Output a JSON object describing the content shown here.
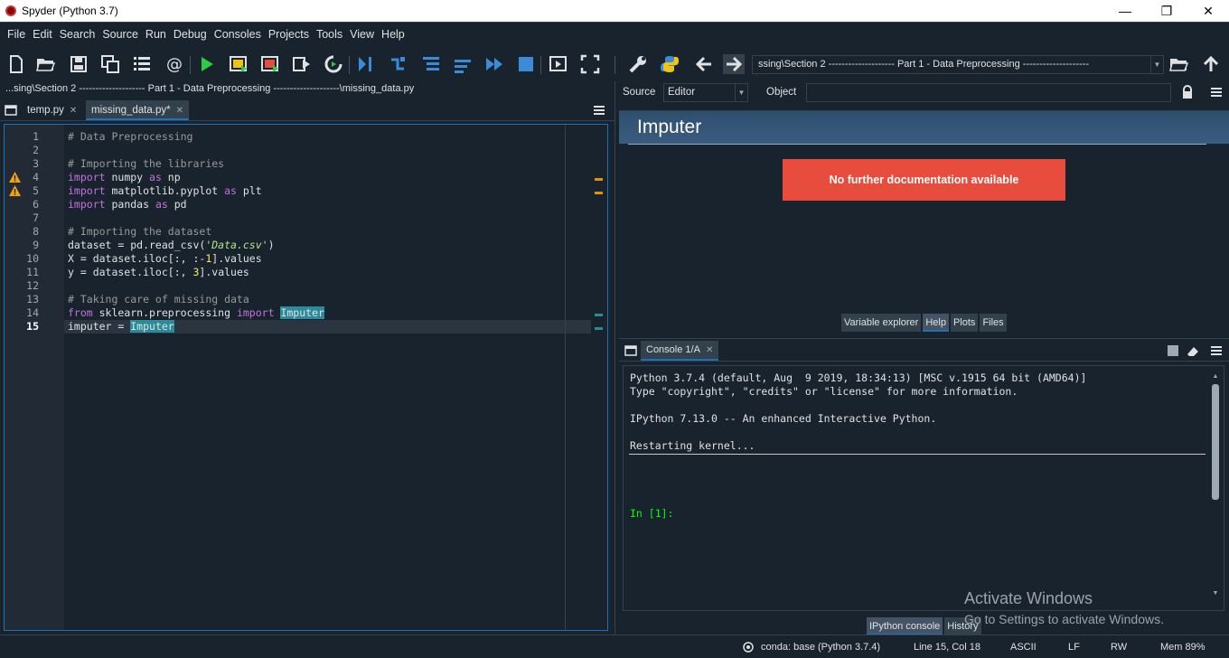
{
  "window": {
    "title": "Spyder (Python 3.7)",
    "min": "—",
    "max": "❐",
    "close": "✕"
  },
  "menu": [
    "File",
    "Edit",
    "Search",
    "Source",
    "Run",
    "Debug",
    "Consoles",
    "Projects",
    "Tools",
    "View",
    "Help"
  ],
  "toolbar": {
    "path": "ssing\\Section 2 -------------------- Part 1 - Data Preprocessing --------------------"
  },
  "editor": {
    "filepath": "...sing\\Section 2 -------------------- Part 1 - Data Preprocessing --------------------\\missing_data.py",
    "tabs": [
      {
        "label": "temp.py",
        "close": "✕"
      },
      {
        "label": "missing_data.py*",
        "close": "✕"
      }
    ],
    "line_numbers": [
      "1",
      "2",
      "3",
      "4",
      "5",
      "6",
      "7",
      "8",
      "9",
      "10",
      "11",
      "12",
      "13",
      "14",
      "15"
    ],
    "current_line": 15,
    "warning_lines": [
      4,
      5
    ],
    "lines": [
      [
        {
          "t": "# Data Preprocessing",
          "c": "com"
        }
      ],
      [],
      [
        {
          "t": "# Importing the libraries",
          "c": "com"
        }
      ],
      [
        {
          "t": "import",
          "c": "kw"
        },
        {
          "t": " numpy ",
          "c": ""
        },
        {
          "t": "as",
          "c": "kw"
        },
        {
          "t": " np",
          "c": ""
        }
      ],
      [
        {
          "t": "import",
          "c": "kw"
        },
        {
          "t": " matplotlib.pyplot ",
          "c": ""
        },
        {
          "t": "as",
          "c": "kw"
        },
        {
          "t": " plt",
          "c": ""
        }
      ],
      [
        {
          "t": "import",
          "c": "kw"
        },
        {
          "t": " pandas ",
          "c": ""
        },
        {
          "t": "as",
          "c": "kw"
        },
        {
          "t": " pd",
          "c": ""
        }
      ],
      [],
      [
        {
          "t": "# Importing the dataset",
          "c": "com"
        }
      ],
      [
        {
          "t": "dataset = pd.read_csv(",
          "c": ""
        },
        {
          "t": "'Data.csv'",
          "c": "str"
        },
        {
          "t": ")",
          "c": ""
        }
      ],
      [
        {
          "t": "X = dataset.iloc[:, :-",
          "c": ""
        },
        {
          "t": "1",
          "c": "num"
        },
        {
          "t": "].values",
          "c": ""
        }
      ],
      [
        {
          "t": "y = dataset.iloc[:, ",
          "c": ""
        },
        {
          "t": "3",
          "c": "num"
        },
        {
          "t": "].values",
          "c": ""
        }
      ],
      [],
      [
        {
          "t": "# Taking care of missing data",
          "c": "com"
        }
      ],
      [
        {
          "t": "from",
          "c": "kw"
        },
        {
          "t": " sklearn.preprocessing ",
          "c": ""
        },
        {
          "t": "import",
          "c": "kw"
        },
        {
          "t": " ",
          "c": ""
        },
        {
          "t": "Imputer",
          "c": "hl"
        }
      ],
      [
        {
          "t": "imputer = ",
          "c": ""
        },
        {
          "t": "Imputer",
          "c": "hl"
        }
      ]
    ]
  },
  "help": {
    "source_label": "Source",
    "source_value": "Editor",
    "object_label": "Object",
    "object_value": "",
    "title": "Imputer",
    "message": "No further documentation available",
    "tabs": [
      "Variable explorer",
      "Help",
      "Plots",
      "Files"
    ],
    "active_tab": "Help"
  },
  "console": {
    "tab": "Console 1/A",
    "tab_close": "✕",
    "lines": [
      "Python 3.7.4 (default, Aug  9 2019, 18:34:13) [MSC v.1915 64 bit (AMD64)]",
      "Type \"copyright\", \"credits\" or \"license\" for more information.",
      "",
      "IPython 7.13.0 -- An enhanced Interactive Python.",
      "",
      "Restarting kernel..."
    ],
    "prompt": "In [1]:",
    "tabs": [
      "IPython console",
      "History"
    ],
    "active_tab": "IPython console"
  },
  "watermark": {
    "line1": "Activate Windows",
    "line2": "Go to Settings to activate Windows."
  },
  "status": {
    "env": "conda: base (Python 3.7.4)",
    "position": "Line 15, Col 18",
    "encoding": "ASCII",
    "eol": "LF",
    "mode": "RW",
    "memory": "Mem 89%"
  },
  "colors": {
    "background": "#19232d",
    "accent": "#1a72bb",
    "error_banner": "#e74c3c",
    "keyword": "#c670e0",
    "comment": "#999999",
    "highlight": "#2a8c9a",
    "prompt": "#00ff00"
  },
  "icons": [
    "new-file-icon",
    "open-file-icon",
    "save-icon",
    "save-all-icon",
    "outline-icon",
    "email-icon",
    "run-icon",
    "run-cell-icon",
    "run-cell-advance-icon",
    "run-selection-icon",
    "rerun-icon",
    "debug-icon",
    "step-icon",
    "step-into-icon",
    "step-return-icon",
    "continue-icon",
    "stop-icon",
    "maximize-pane-icon",
    "fullscreen-icon",
    "preferences-icon",
    "python-path-icon",
    "back-icon",
    "forward-icon",
    "browse-folder-icon",
    "parent-dir-icon"
  ]
}
